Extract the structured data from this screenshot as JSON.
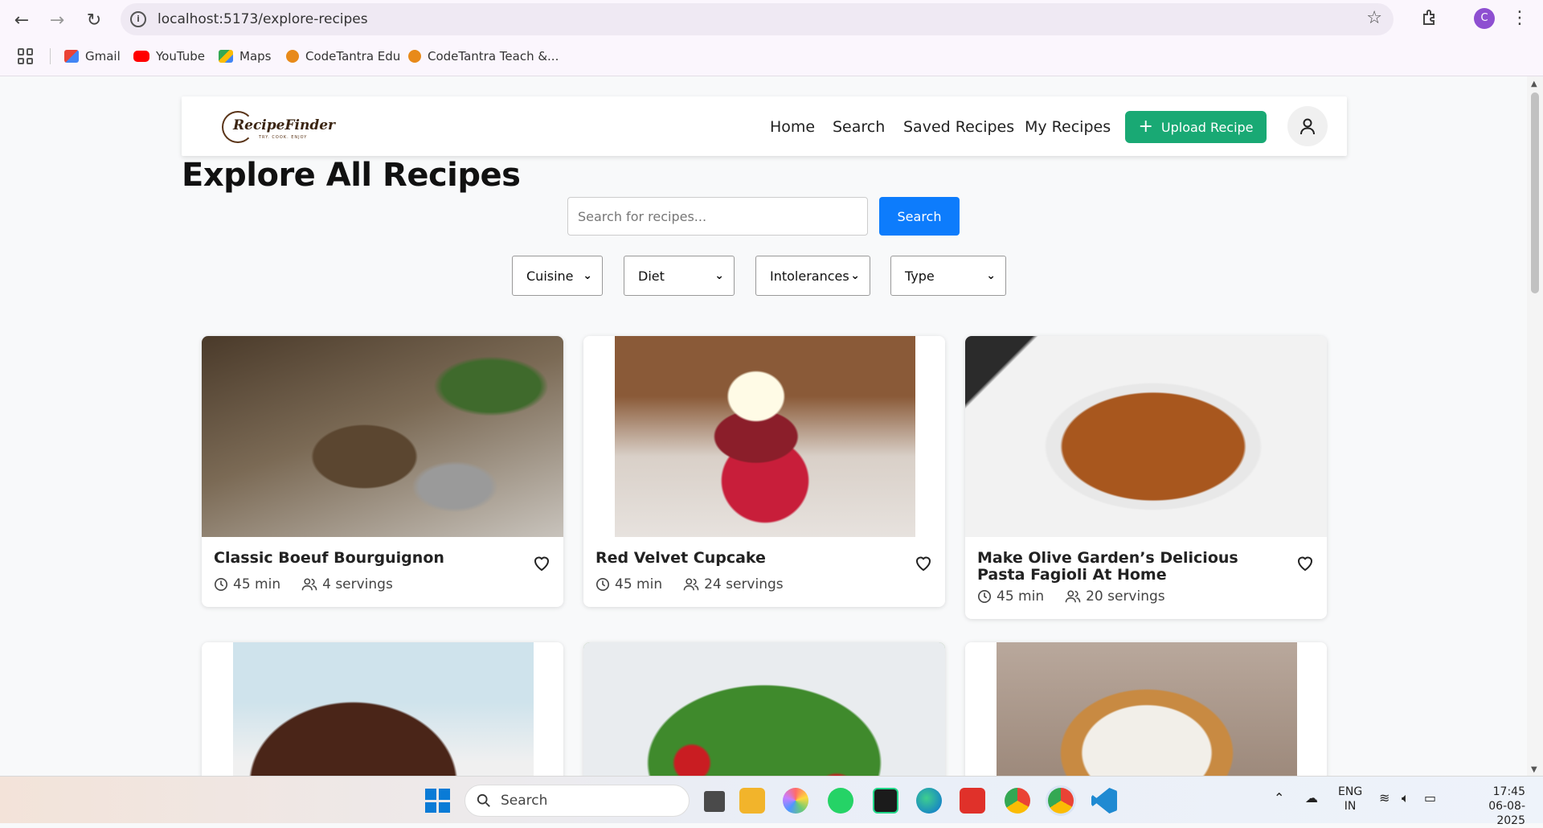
{
  "browser": {
    "url": "localhost:5173/explore-recipes",
    "profile_initial": "C",
    "bookmarks": [
      {
        "label": "Gmail",
        "icon": "gmail-icon"
      },
      {
        "label": "YouTube",
        "icon": "youtube-icon"
      },
      {
        "label": "Maps",
        "icon": "maps-icon"
      },
      {
        "label": "CodeTantra Edu",
        "icon": "codetantra-icon"
      },
      {
        "label": "CodeTantra Teach &...",
        "icon": "codetantra-icon"
      }
    ]
  },
  "app": {
    "logo_text": "RecipeFinder",
    "logo_tagline": "TRY. COOK. ENJOY",
    "nav": {
      "home": "Home",
      "search": "Search",
      "saved": "Saved Recipes",
      "mine": "My Recipes",
      "upload": "Upload Recipe"
    },
    "page_title": "Explore All Recipes",
    "search": {
      "placeholder": "Search for recipes...",
      "button": "Search"
    },
    "filters": {
      "cuisine": "Cuisine",
      "diet": "Diet",
      "intolerances": "Intolerances",
      "type": "Type"
    },
    "recipes": [
      {
        "title": "Classic Boeuf Bourguignon",
        "time": "45 min",
        "servings": "4 servings"
      },
      {
        "title": "Red Velvet Cupcake",
        "time": "45 min",
        "servings": "24 servings"
      },
      {
        "title": "Make Olive Garden’s Delicious Pasta Fagioli At Home",
        "time": "45 min",
        "servings": "20 servings"
      }
    ]
  },
  "taskbar": {
    "search_label": "Search",
    "lang_1": "ENG",
    "lang_2": "IN",
    "time": "17:45",
    "date": "06-08-2025"
  },
  "colors": {
    "accent_green": "#19a974",
    "accent_blue": "#0d7cfc"
  }
}
